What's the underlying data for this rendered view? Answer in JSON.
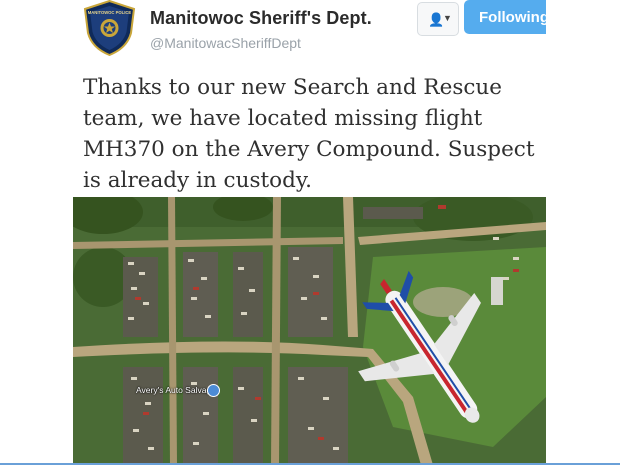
{
  "account": {
    "display_name": "Manitowoc Sheriff's Dept.",
    "handle": "@ManitowacSheriffDept",
    "badge_text": "MANITOWOC POLICE"
  },
  "actions": {
    "user_menu_icon": "person-dropdown-icon",
    "following_label": "Following"
  },
  "tweet": {
    "text": "Thanks to our new Search and Rescue\nteam, we have located missing flight\nMH370 on the Avery Compound. Suspect\nis already in custody."
  },
  "media": {
    "map_label": "Avery's Auto Salvage",
    "colors": {
      "grass": "#4a6b35",
      "dirt": "#b9a67e",
      "plane_body": "#f4f4f4",
      "plane_stripe": "#c8262e",
      "plane_tail": "#1f4ea8"
    }
  },
  "colors": {
    "accent": "#55acee",
    "name_text": "#2b2b2b",
    "handle_text": "#9aa2a9"
  }
}
